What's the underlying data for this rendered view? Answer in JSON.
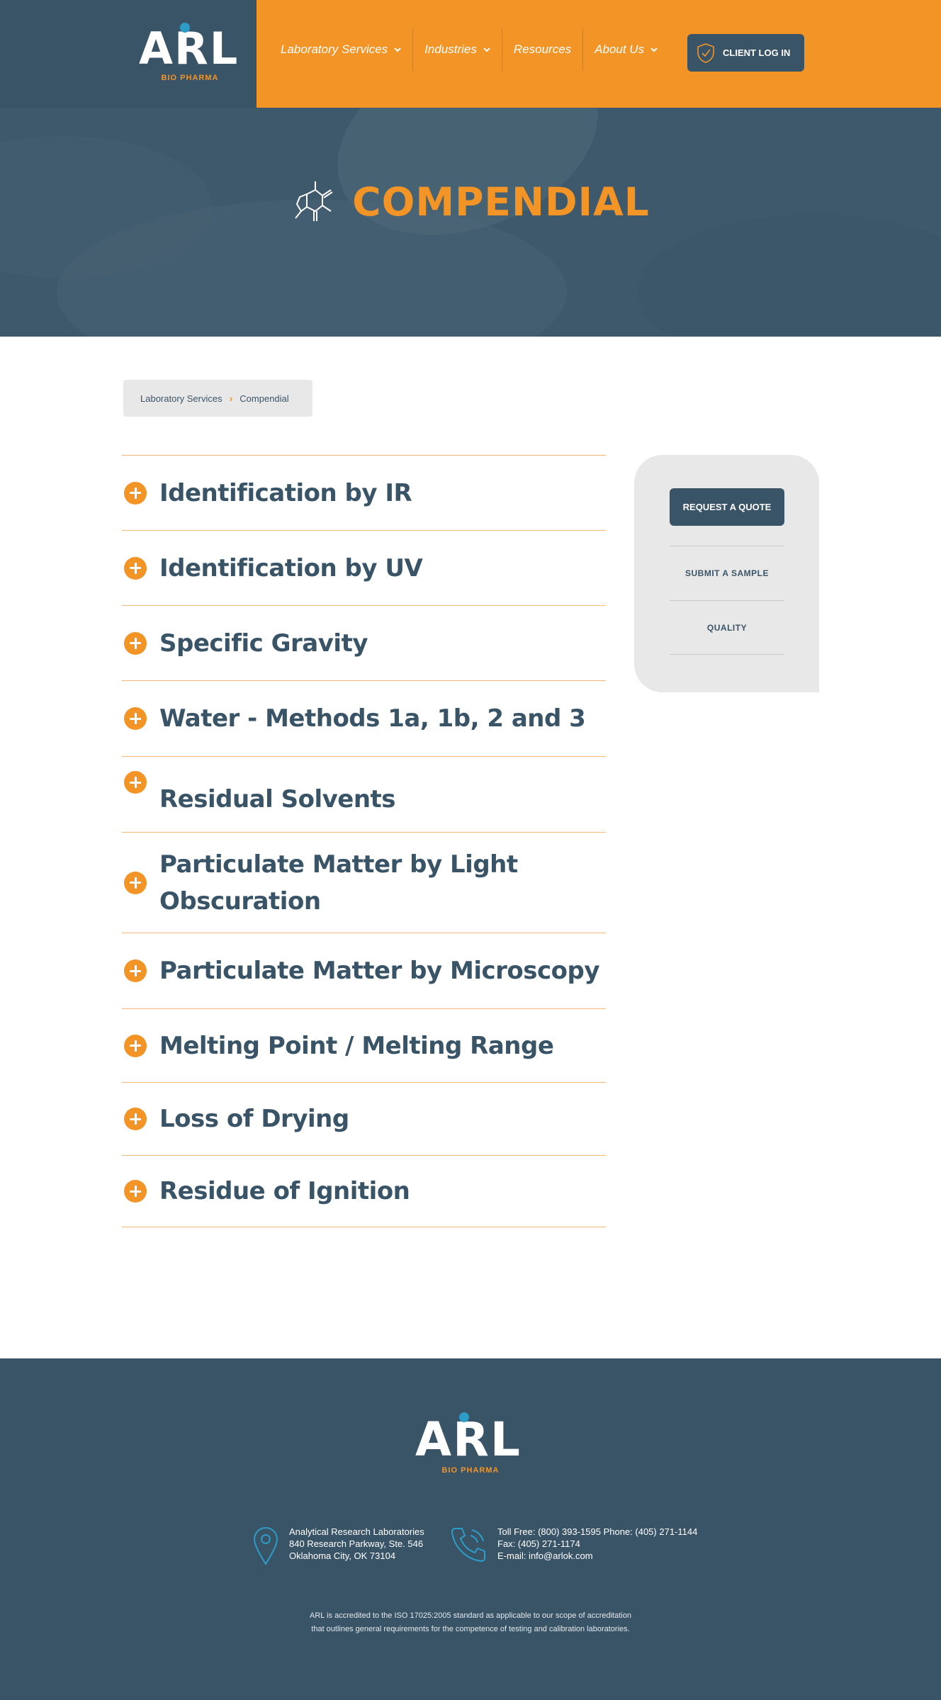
{
  "header": {
    "logo_text": "ARL",
    "logo_sub": "BIO PHARMA",
    "nav": [
      {
        "label": "Laboratory Services",
        "has_dropdown": true
      },
      {
        "label": "Industries",
        "has_dropdown": true
      },
      {
        "label": "Resources",
        "has_dropdown": false
      },
      {
        "label": "About Us",
        "has_dropdown": true
      }
    ],
    "login_label": "CLIENT LOG IN"
  },
  "hero": {
    "title": "COMPENDIAL",
    "icon": "molecule-icon"
  },
  "breadcrumb": {
    "parent": "Laboratory Services",
    "current": "Compendial"
  },
  "accordion": [
    {
      "label": "Identification by IR"
    },
    {
      "label": "Identification by UV"
    },
    {
      "label": "Specific Gravity"
    },
    {
      "label": "Water - Methods 1a, 1b, 2 and 3"
    },
    {
      "label": "Residual Solvents"
    },
    {
      "label": "Particulate Matter by Light Obscuration"
    },
    {
      "label": "Particulate Matter by Microscopy"
    },
    {
      "label": "Melting Point / Melting Range"
    },
    {
      "label": "Loss of Drying"
    },
    {
      "label": "Residue of Ignition"
    }
  ],
  "sidebar": {
    "quote_label": "REQUEST A QUOTE",
    "links": [
      "SUBMIT A SAMPLE",
      "QUALITY"
    ]
  },
  "footer": {
    "logo_text": "ARL",
    "logo_sub": "BIO PHARMA",
    "address": [
      "Analytical Research Laboratories",
      "840 Research Parkway, Ste. 546",
      "Oklahoma City, OK 73104"
    ],
    "phone": [
      "Toll Free: (800) 393-1595 Phone: (405) 271-1144",
      "Fax: (405) 271-1174",
      "E-mail: info@arlok.com"
    ],
    "legal": [
      "ARL is accredited to the ISO 17025:2005 standard as applicable to our scope of accreditation",
      "that outlines general requirements for the competence of testing and calibration laboratories."
    ]
  },
  "colors": {
    "navy": "#3a5467",
    "orange": "#f39426",
    "light_gray": "#e8e8e9",
    "accent_blue": "#2d9cc7"
  }
}
